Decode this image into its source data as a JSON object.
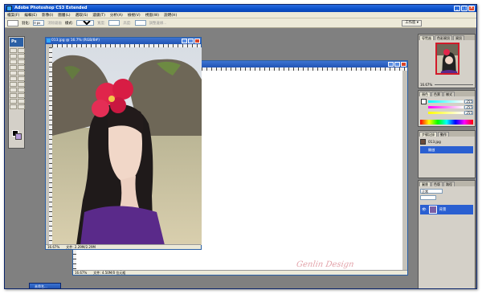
{
  "app": {
    "title": "Adobe Photoshop CS3 Extended",
    "window_buttons": [
      "_",
      "□",
      "×"
    ]
  },
  "menubar": {
    "items": [
      "檔案(F)",
      "編輯(E)",
      "影像(I)",
      "圖層(L)",
      "選取(S)",
      "濾鏡(T)",
      "分析(A)",
      "檢視(V)",
      "視窗(W)",
      "說明(H)"
    ]
  },
  "options": {
    "feather_label": "羽化:",
    "feather_value": "0 px",
    "antialias_label": "消除鋸齒",
    "style_label": "樣式:",
    "style_value": "正常",
    "width_label": "寬度:",
    "height_label": "高度:",
    "refine_label": "調整邊緣...",
    "workspace_label": "工作區 ▾"
  },
  "document1": {
    "title": "013.jpg @ 16.7% (RGB/8#)",
    "zoom": "16.67%",
    "doc_info": "文件: 2.29M/2.29M"
  },
  "document2": {
    "zoom": "16.67%",
    "doc_info": "文件: 4.50M/0 位元組"
  },
  "signature": "Genlin Design",
  "minimized_doc": "未命名...",
  "panels": {
    "navigator": {
      "tabs": [
        "導覽器",
        "色彩資訊",
        "資訊"
      ],
      "zoom": "16.67%"
    },
    "color": {
      "tabs": [
        "顏色",
        "色票",
        "樣式"
      ],
      "channels": [
        {
          "label": "R",
          "value": "255"
        },
        {
          "label": "G",
          "value": "255"
        },
        {
          "label": "B",
          "value": "255"
        }
      ]
    },
    "history": {
      "tabs": [
        "步驟記錄",
        "動作"
      ],
      "items": [
        {
          "label": "013.jpg"
        },
        {
          "label": "開啟"
        }
      ]
    },
    "layers": {
      "tabs": [
        "圖層",
        "色版",
        "路徑"
      ],
      "blend_mode": "正常",
      "layer_name": "背景"
    }
  }
}
